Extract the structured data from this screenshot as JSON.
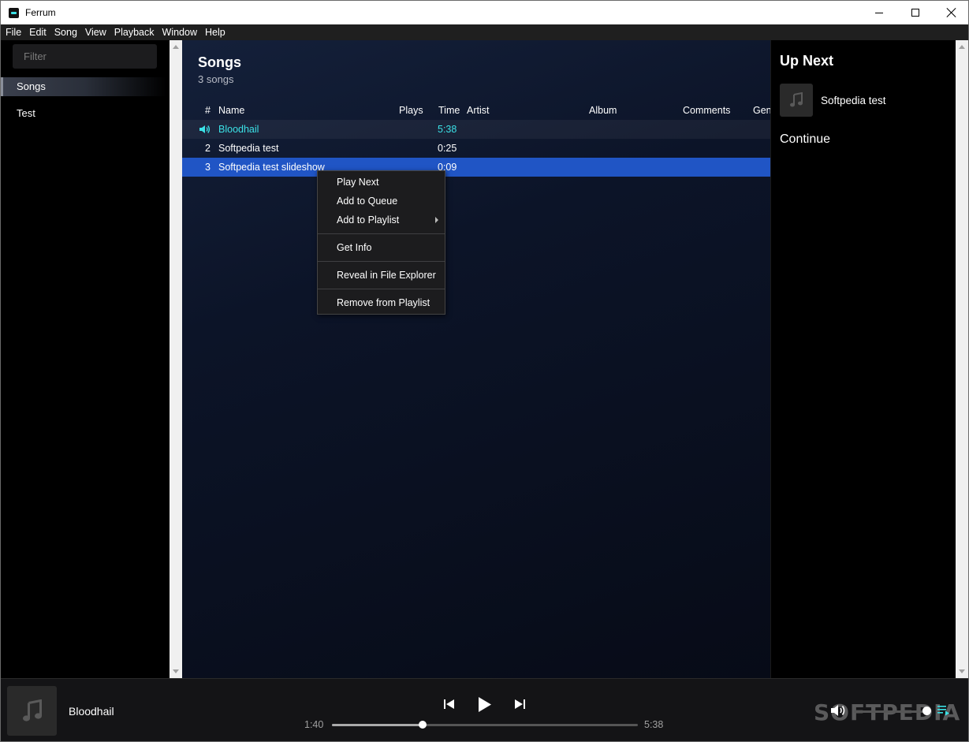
{
  "window": {
    "title": "Ferrum",
    "icon": "ferrum-app-icon"
  },
  "menubar": [
    "File",
    "Edit",
    "Song",
    "View",
    "Playback",
    "Window",
    "Help"
  ],
  "sidebar": {
    "filter_placeholder": "Filter",
    "items": [
      {
        "label": "Songs",
        "active": true
      },
      {
        "label": "Test",
        "active": false
      }
    ]
  },
  "main": {
    "title": "Songs",
    "subtitle": "3 songs",
    "columns": [
      "#",
      "Name",
      "Plays",
      "Time",
      "Artist",
      "Album",
      "Comments",
      "Genr"
    ],
    "rows": [
      {
        "num": "",
        "name": "Bloodhail",
        "plays": "",
        "time": "5:38",
        "state": "playing"
      },
      {
        "num": "2",
        "name": "Softpedia test",
        "plays": "",
        "time": "0:25",
        "state": "normal"
      },
      {
        "num": "3",
        "name": "Softpedia test slideshow",
        "plays": "",
        "time": "0:09",
        "state": "selected"
      }
    ]
  },
  "context_menu": {
    "items": [
      "Play Next",
      "Add to Queue",
      "Add to Playlist",
      "Get Info",
      "Reveal in File Explorer",
      "Remove from Playlist"
    ]
  },
  "up_next": {
    "title": "Up Next",
    "song": "Softpedia test",
    "continue_label": "Continue"
  },
  "player": {
    "song": "Bloodhail",
    "elapsed": "1:40",
    "duration": "5:38",
    "progress": 0.296,
    "volume": 0.94,
    "watermark": "SOFTPEDIA"
  },
  "colors": {
    "accent": "#3be1e6",
    "selection": "#2055c5"
  }
}
